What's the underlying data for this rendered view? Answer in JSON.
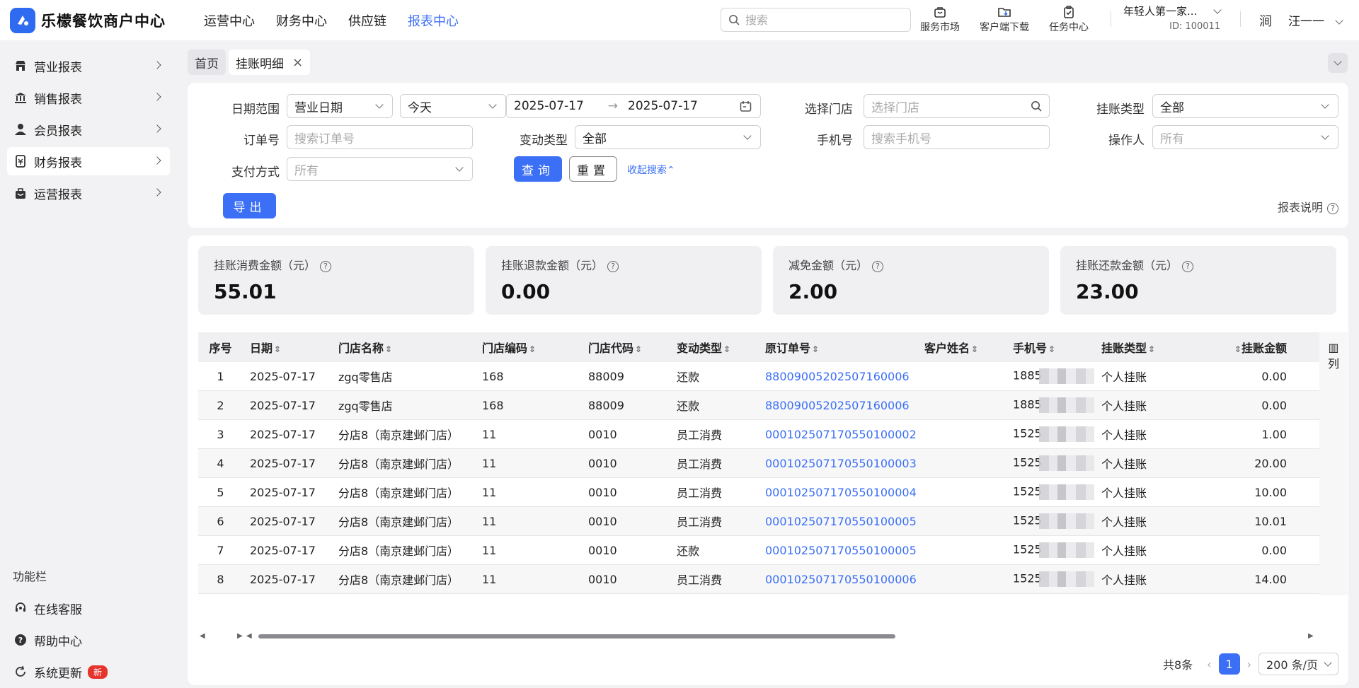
{
  "header": {
    "app_title": "乐檬餐饮商户中心",
    "nav": [
      "运营中心",
      "财务中心",
      "供应链",
      "报表中心"
    ],
    "active_nav": "报表中心",
    "search_placeholder": "搜索",
    "tools": [
      "服务市场",
      "客户端下载",
      "任务中心"
    ],
    "shop_name": "年轻人第一家...",
    "shop_id": "ID: 100011",
    "avatar_text": "涧",
    "username": "汪一一"
  },
  "sidebar": {
    "items": [
      "营业报表",
      "销售报表",
      "会员报表",
      "财务报表",
      "运营报表"
    ],
    "active": "财务报表",
    "func_title": "功能栏",
    "func_items": [
      "在线客服",
      "帮助中心",
      "系统更新"
    ],
    "new_badge": "新"
  },
  "tabs": [
    "首页",
    "挂账明细"
  ],
  "filters": {
    "date_range_label": "日期范围",
    "date_type": "营业日期",
    "date_preset": "今天",
    "date_start": "2025-07-17",
    "date_end": "2025-07-17",
    "store_label": "选择门店",
    "store_placeholder": "选择门店",
    "acc_type_label": "挂账类型",
    "acc_type_value": "全部",
    "order_label": "订单号",
    "order_placeholder": "搜索订单号",
    "change_type_label": "变动类型",
    "change_type_value": "全部",
    "phone_label": "手机号",
    "phone_placeholder": "搜索手机号",
    "operator_label": "操作人",
    "operator_value": "所有",
    "pay_label": "支付方式",
    "pay_value": "所有",
    "query_btn": "查询",
    "reset_btn": "重置",
    "collapse_link": "收起搜索",
    "export_btn": "导出",
    "report_desc": "报表说明"
  },
  "stats": [
    {
      "title": "挂账消费金额（元）",
      "value": "55.01"
    },
    {
      "title": "挂账退款金额（元）",
      "value": "0.00"
    },
    {
      "title": "减免金额（元）",
      "value": "2.00"
    },
    {
      "title": "挂账还款金额（元）",
      "value": "23.00"
    }
  ],
  "table": {
    "columns": [
      "序号",
      "日期",
      "门店名称",
      "门店编码",
      "门店代码",
      "变动类型",
      "原订单号",
      "客户姓名",
      "手机号",
      "挂账类型",
      "挂账金额"
    ],
    "col_setting": "列",
    "rows": [
      [
        "1",
        "2025-07-17",
        "zgq零售店",
        "168",
        "88009",
        "还款",
        "88009005202507160006",
        "",
        "1885",
        "个人挂账",
        "0.00"
      ],
      [
        "2",
        "2025-07-17",
        "zgq零售店",
        "168",
        "88009",
        "还款",
        "88009005202507160006",
        "",
        "1885",
        "个人挂账",
        "0.00"
      ],
      [
        "3",
        "2025-07-17",
        "分店8（南京建邺门店）",
        "11",
        "0010",
        "员工消费",
        "00010250717055010000​2",
        "",
        "1525",
        "个人挂账",
        "1.00"
      ],
      [
        "4",
        "2025-07-17",
        "分店8（南京建邺门店）",
        "11",
        "0010",
        "员工消费",
        "00010250717055010000​3",
        "",
        "1525",
        "个人挂账",
        "20.00"
      ],
      [
        "5",
        "2025-07-17",
        "分店8（南京建邺门店）",
        "11",
        "0010",
        "员工消费",
        "00010250717055010000​4",
        "",
        "1525",
        "个人挂账",
        "10.00"
      ],
      [
        "6",
        "2025-07-17",
        "分店8（南京建邺门店）",
        "11",
        "0010",
        "员工消费",
        "00010250717055010000​5",
        "",
        "1525",
        "个人挂账",
        "10.01"
      ],
      [
        "7",
        "2025-07-17",
        "分店8（南京建邺门店）",
        "11",
        "0010",
        "还款",
        "00010250717055010000​5",
        "",
        "1525",
        "个人挂账",
        "0.00"
      ],
      [
        "8",
        "2025-07-17",
        "分店8（南京建邺门店）",
        "11",
        "0010",
        "员工消费",
        "00010250717055010000​6",
        "",
        "1525",
        "个人挂账",
        "14.00"
      ]
    ]
  },
  "pagination": {
    "total": "共8条",
    "current": "1",
    "page_size": "200 条/页"
  },
  "colors": {
    "primary": "#3b6ff5",
    "badge": "#e5342c"
  }
}
